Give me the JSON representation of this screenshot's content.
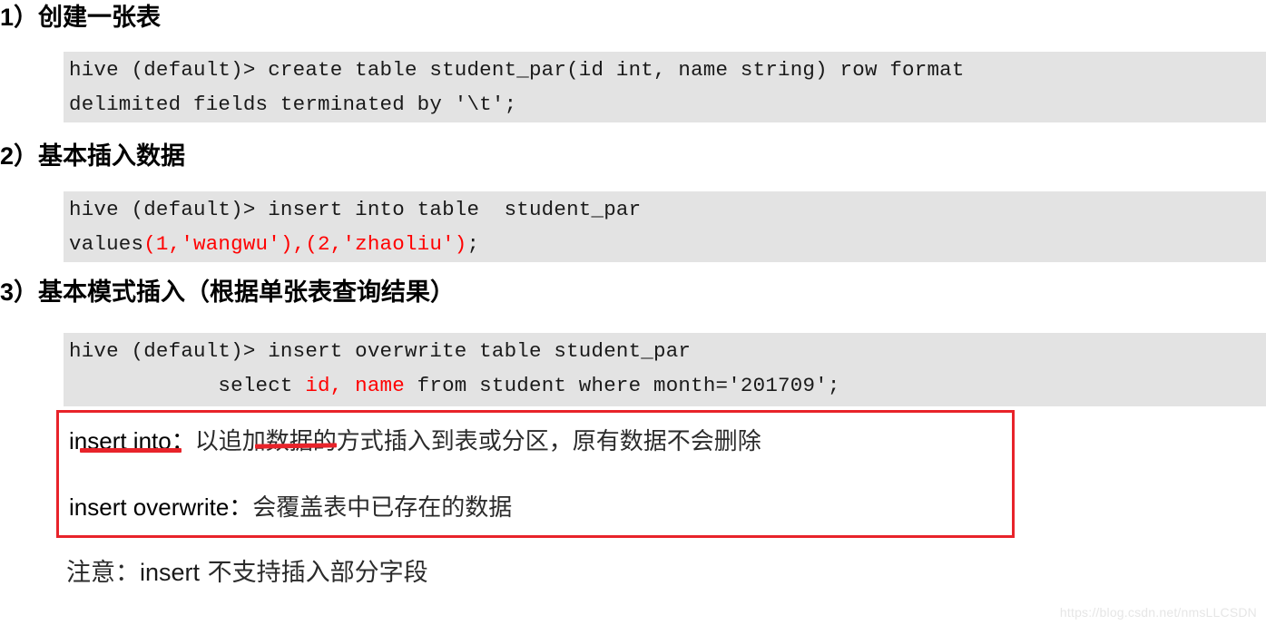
{
  "document": {
    "watermark": "https://blog.csdn.net/nmsLLCSDN"
  },
  "sections": [
    {
      "number": "1）",
      "title": "创建一张表",
      "code": {
        "line1": "hive (default)> create table student_par(id int, name string) row format",
        "line2": "delimited fields terminated by '\\t';"
      }
    },
    {
      "number": "2）",
      "title": "基本插入数据",
      "code": {
        "line1": "hive (default)> insert into table  student_par",
        "line2_prefix": "values",
        "line2_red": "(1,'wangwu'),(2,'zhaoliu')",
        "line2_suffix": ";"
      }
    },
    {
      "number": "3）",
      "title": "基本模式插入（根据单张表查询结果）",
      "code": {
        "line1": "hive (default)> insert overwrite table student_par",
        "line2_prefix": "            select ",
        "line2_red": "id, name",
        "line2_suffix": " from student where month='201709';"
      }
    }
  ],
  "note_box": {
    "line1": {
      "keyword": "insert into",
      "colon": "：",
      "text": "以追加数据的方式插入到表或分区，原有数据不会删除"
    },
    "line2": {
      "keyword": "insert overwrite",
      "colon": "：",
      "text": "会覆盖表中已存在的数据"
    },
    "border_color": "#e8232a"
  },
  "footer": {
    "prefix": "注意：",
    "keyword": "insert",
    "text": " 不支持插入部分字段"
  }
}
